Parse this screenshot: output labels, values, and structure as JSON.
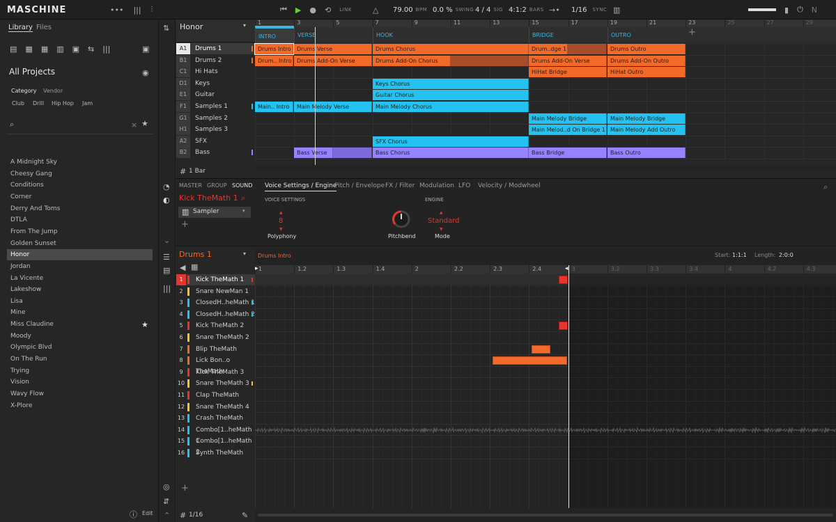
{
  "toolbar": {
    "logo": "MASCHINE",
    "bpm": "79.00",
    "bpm_label": "BPM",
    "swing": "0.0 %",
    "swing_label": "SWING",
    "sig": "4 / 4",
    "sig_label": "SIG",
    "bars": "4:1:2",
    "bars_label": "BARS",
    "quant": "1/16",
    "sync_label": "SYNC",
    "link_label": "LINK"
  },
  "library": {
    "tab_library": "Library",
    "tab_files": "Files",
    "title": "All Projects",
    "filter_category": "Category",
    "filter_vendor": "Vendor",
    "tags": [
      "Club",
      "Drill",
      "Hip Hop",
      "Jam"
    ],
    "projects": [
      "A Midnight Sky",
      "Cheesy Gang",
      "Conditions",
      "Corner",
      "Derry And Toms",
      "DTLA",
      "From The Jump",
      "Golden Sunset",
      "Honor",
      "Jordan",
      "La Vicente",
      "Lakeshow",
      "Lisa",
      "Mine",
      "Miss Claudine",
      "Moody",
      "Olympic Blvd",
      "On The Run",
      "Trying",
      "Vision",
      "Wavy Flow",
      "X-Plore"
    ],
    "edit_label": "Edit"
  },
  "arranger": {
    "project": "Honor",
    "bar_length": "1 Bar",
    "groups": [
      {
        "key": "A1",
        "name": "Drums 1"
      },
      {
        "key": "B1",
        "name": "Drums 2"
      },
      {
        "key": "C1",
        "name": "Hi Hats"
      },
      {
        "key": "D1",
        "name": "Keys"
      },
      {
        "key": "E1",
        "name": "Guitar"
      },
      {
        "key": "F1",
        "name": "Samples 1"
      },
      {
        "key": "G1",
        "name": "Samples 2"
      },
      {
        "key": "H1",
        "name": "Samples 3"
      },
      {
        "key": "A2",
        "name": "SFX"
      },
      {
        "key": "B2",
        "name": "Bass"
      }
    ],
    "ruler": [
      "1",
      "3",
      "5",
      "7",
      "9",
      "11",
      "13",
      "15",
      "17",
      "19",
      "21",
      "23",
      "25",
      "27",
      "29"
    ],
    "sections": [
      "INTRO",
      "VERSE",
      "HOOK",
      "BRIDGE",
      "OUTRO"
    ],
    "clips": [
      "Drums Intro",
      "Drums Verse",
      "Drums Chorus",
      "Drum..dge 1",
      "Drums Outro",
      "Drum.. Intro",
      "Drums Add-On Verse",
      "Drums Add-On Chorus",
      "Drums Add-On Verse",
      "Drums Add-On Outro",
      "HiHat Bridge",
      "HiHat Outro",
      "Keys Chorus",
      "Guitar Chorus",
      "Main.. Intro",
      "Main Melody Verse",
      "Main Melody Chorus",
      "Main Melody Bridge",
      "Main Melody Bridge",
      "Main Melod..d On Bridge 1",
      "Main Melody Add Outro",
      "SFX Chorus",
      "Bass Verse",
      "Bass Chorus",
      "Bass Bridge",
      "Bass Outro"
    ]
  },
  "sound": {
    "tab_master": "MASTER",
    "tab_group": "GROUP",
    "tab_sound": "SOUND",
    "name": "Kick TheMath 1",
    "plugin": "Sampler",
    "tabs": [
      "Voice Settings / Engine",
      "Pitch / Envelope",
      "FX / Filter",
      "Modulation",
      "LFO",
      "Velocity / Modwheel"
    ],
    "voice_settings": "VOICE SETTINGS",
    "engine": "ENGINE",
    "polyphony_val": "8",
    "polyphony": "Polyphony",
    "pitchbend": "Pitchbend",
    "mode_val": "Standard",
    "mode": "Mode"
  },
  "pattern": {
    "group": "Drums 1",
    "name": "Drums Intro",
    "start_label": "Start:",
    "start": "1:1:1",
    "length_label": "Length:",
    "length": "2:0:0",
    "grid": "1/16",
    "ruler": [
      "1",
      "1.2",
      "1.3",
      "1.4",
      "2",
      "2.2",
      "2.3",
      "2.4",
      "3",
      "3.2",
      "3.3",
      "3.4",
      "4",
      "4.2",
      "4.3"
    ],
    "sounds": [
      "Kick TheMath 1",
      "Snare NewMan 1",
      "ClosedH..heMath 1",
      "ClosedH..heMath 2",
      "Kick TheMath 2",
      "Snare TheMath 2",
      "Blip TheMath",
      "Lick Bon..o TheMath",
      "Kick TheMath 3",
      "Snare TheMath 3",
      "Clap TheMath",
      "Snare TheMath 4",
      "Crash TheMath",
      "Combo[1..heMath 1",
      "Combo[1..heMath 2",
      "Synth TheMath"
    ]
  },
  "colors": {
    "orange": "#f26a2a",
    "cyan": "#23c2f0",
    "violet": "#9583ff",
    "red": "#e8342f",
    "accent_blue": "#3db4e0"
  }
}
